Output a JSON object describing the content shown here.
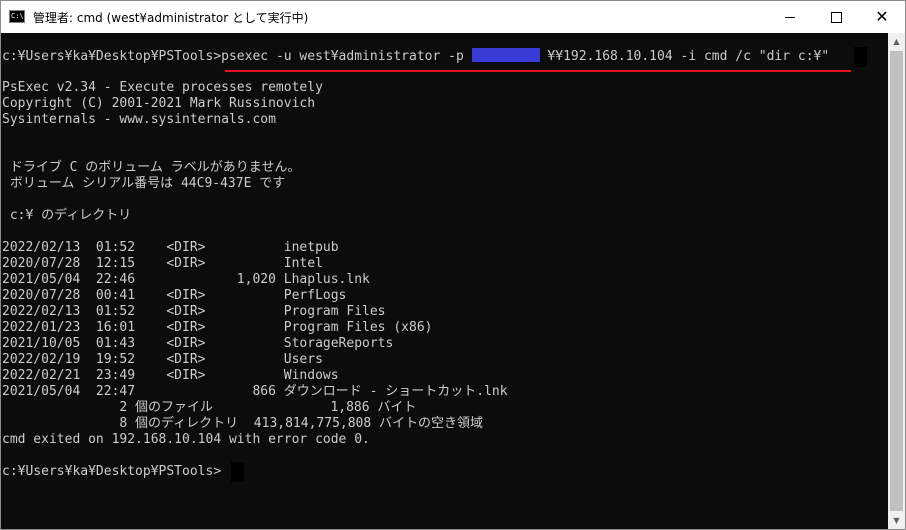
{
  "window": {
    "title": "管理者: cmd (west¥administrator として実行中)",
    "app_icon_text": "C:\\",
    "app_icon": "cmd-icon",
    "minimize_icon": "minimize-icon",
    "maximize_icon": "maximize-icon",
    "close_icon": "close-icon",
    "close_glyph": "✕"
  },
  "console": {
    "command_prompt": "c:¥Users¥ka¥Desktop¥PSTools>",
    "command_part1": "psexec -u west¥administrator -p ",
    "command_part2": " ¥¥192.168.10.104 -i cmd /c \"dir c:¥\"",
    "lines": [
      "PsExec v2.34 - Execute processes remotely",
      "Copyright (C) 2001-2021 Mark Russinovich",
      "Sysinternals - www.sysinternals.com",
      " ドライブ C のボリューム ラベルがありません。",
      " ボリューム シリアル番号は 44C9-437E です",
      " c:¥ のディレクトリ",
      "2022/02/13  01:52    <DIR>          inetpub",
      "2020/07/28  12:15    <DIR>          Intel",
      "2021/05/04  22:46             1,020 Lhaplus.lnk",
      "2020/07/28  00:41    <DIR>          PerfLogs",
      "2022/02/13  01:52    <DIR>          Program Files",
      "2022/01/23  16:01    <DIR>          Program Files (x86)",
      "2021/10/05  01:43    <DIR>          StorageReports",
      "2022/02/19  19:52    <DIR>          Users",
      "2022/02/21  23:49    <DIR>          Windows",
      "2021/05/04  22:47               866 ダウンロード - ショートカット.lnk",
      "               2 個のファイル               1,886 バイト",
      "               8 個のディレクトリ  413,814,775,808 バイトの空き領域",
      "cmd exited on 192.168.10.104 with error code 0.",
      "c:¥Users¥ka¥Desktop¥PSTools>"
    ]
  },
  "colors": {
    "console_bg": "#0c0c0c",
    "console_text": "#cccccc",
    "highlight_underline": "#e81123",
    "redaction": "#3a3ad4"
  }
}
